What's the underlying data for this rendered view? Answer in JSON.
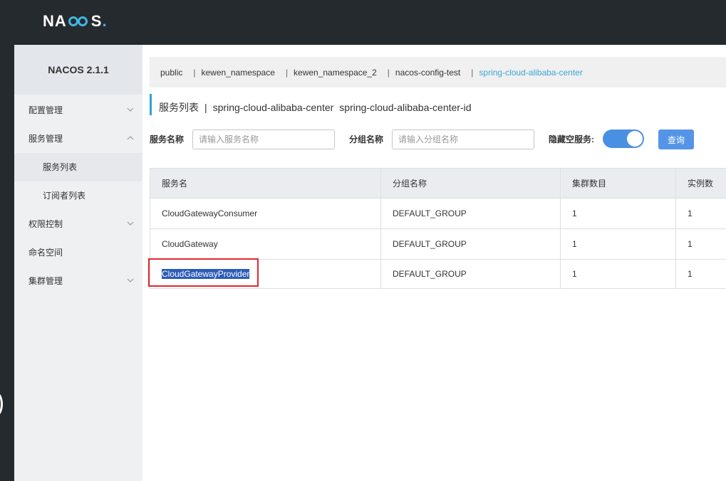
{
  "header": {
    "logo_text": "NACOS."
  },
  "sidebar": {
    "version": "NACOS 2.1.1",
    "items": [
      {
        "label": "配置管理",
        "chevron": "down"
      },
      {
        "label": "服务管理",
        "chevron": "up"
      },
      {
        "label": "服务列表",
        "sub": true,
        "active": true
      },
      {
        "label": "订阅者列表",
        "sub": true
      },
      {
        "label": "权限控制",
        "chevron": "down"
      },
      {
        "label": "命名空间"
      },
      {
        "label": "集群管理",
        "chevron": "down"
      }
    ]
  },
  "namespaces": [
    {
      "label": "public"
    },
    {
      "label": "kewen_namespace"
    },
    {
      "label": "kewen_namespace_2"
    },
    {
      "label": "nacos-config-test"
    },
    {
      "label": "spring-cloud-alibaba-center",
      "active": true
    }
  ],
  "title": {
    "main": "服务列表",
    "separator": "|",
    "namespace_name": "spring-cloud-alibaba-center",
    "namespace_id": "spring-cloud-alibaba-center-id"
  },
  "filter": {
    "service_label": "服务名称",
    "service_placeholder": "请输入服务名称",
    "group_label": "分组名称",
    "group_placeholder": "请输入分组名称",
    "hide_empty_label": "隐藏空服务:",
    "hide_empty_on": true,
    "query_label": "查询"
  },
  "table": {
    "columns": [
      "服务名",
      "分组名称",
      "集群数目",
      "实例数"
    ],
    "rows": [
      [
        "CloudGatewayConsumer",
        "DEFAULT_GROUP",
        "1",
        "1"
      ],
      [
        "CloudGateway",
        "DEFAULT_GROUP",
        "1",
        "1"
      ],
      [
        "CloudGatewayProvider",
        "DEFAULT_GROUP",
        "1",
        "1"
      ]
    ]
  },
  "colors": {
    "topbar": "#252a2f",
    "accent": "#3aa5d8",
    "toggle_on": "#4a90e2",
    "highlight": "#e0282e"
  }
}
